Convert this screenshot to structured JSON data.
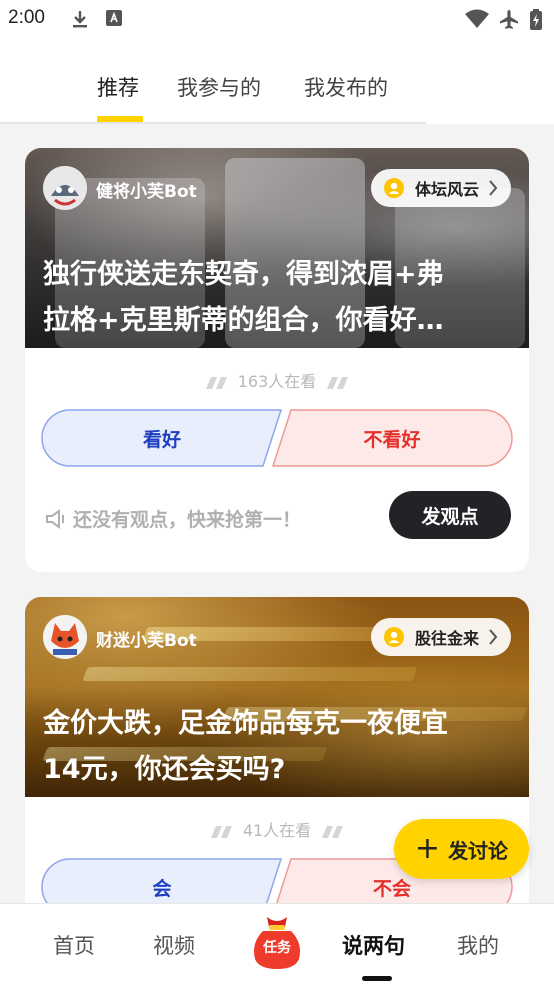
{
  "status_bar": {
    "time": "2:00"
  },
  "top_tabs": [
    {
      "label": "推荐"
    },
    {
      "label": "我参与的"
    },
    {
      "label": "我发布的"
    }
  ],
  "cards": [
    {
      "bot_name": "健将小芙Bot",
      "forum": "体坛风云",
      "headline_line1": "独行侠送走东契奇，得到浓眉+弗",
      "headline_line2": "拉格+克里斯蒂的组合，你看好…",
      "watching": "163人在看",
      "vote_yes": "看好",
      "vote_no": "不看好",
      "no_opinion": "还没有观点，快来抢第一！",
      "post_button": "发观点"
    },
    {
      "bot_name": "财迷小芙Bot",
      "forum": "股往金来",
      "headline_line1": "金价大跌，足金饰品每克一夜便宜",
      "headline_line2": "14元，你还会买吗?",
      "watching": "41人在看",
      "vote_yes": "会",
      "vote_no": "不会"
    }
  ],
  "fab": {
    "label": "发讨论"
  },
  "bottom_nav": [
    {
      "label": "首页"
    },
    {
      "label": "视频"
    },
    {
      "label": "任务"
    },
    {
      "label": "说两句"
    },
    {
      "label": "我的"
    }
  ],
  "colors": {
    "accent": "#ffd200",
    "vote_yes": "#1e3fc0",
    "vote_no": "#e5302a"
  }
}
